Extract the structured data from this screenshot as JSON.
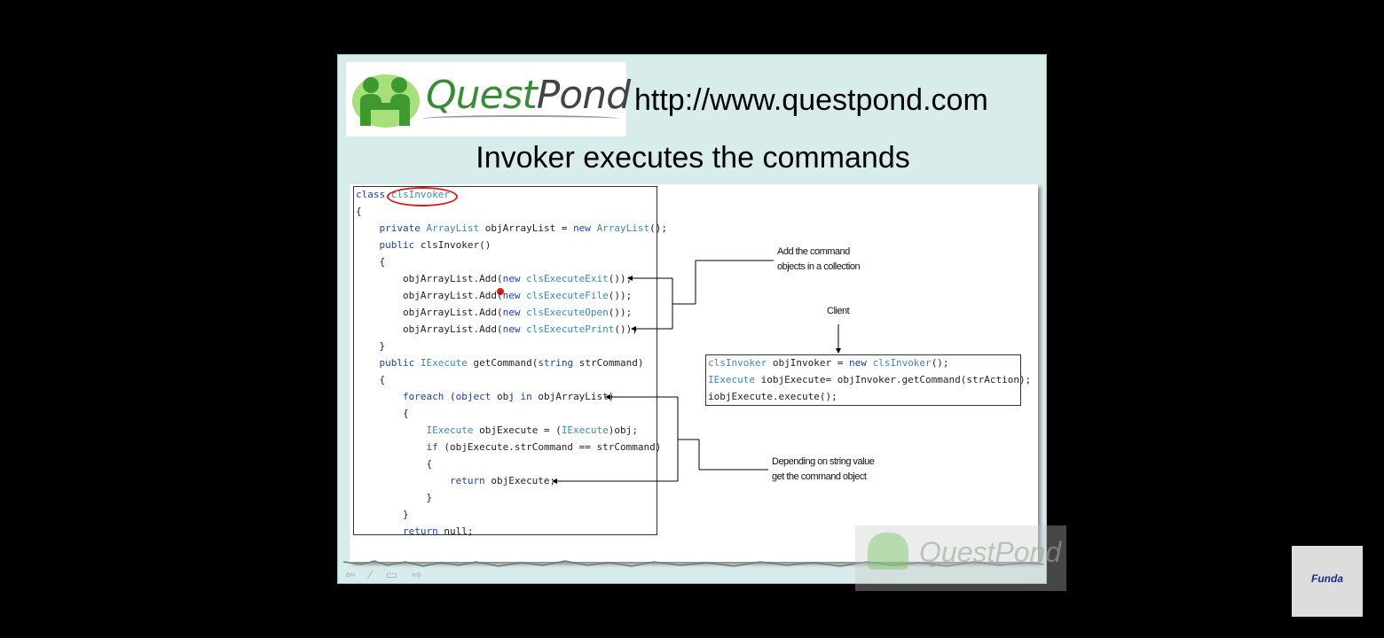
{
  "slide": {
    "logo": {
      "quest": "Quest",
      "pond": "Pond"
    },
    "url": "http://www.questpond.com",
    "heading": "Invoker executes the commands"
  },
  "code": [
    [
      {
        "t": "class ",
        "c": "kw"
      },
      {
        "t": "clsInvoker",
        "c": "ty"
      }
    ],
    [
      {
        "t": "{",
        "c": ""
      }
    ],
    [
      {
        "t": "    ",
        "c": ""
      },
      {
        "t": "private ",
        "c": "kw"
      },
      {
        "t": "ArrayList",
        "c": "ty"
      },
      {
        "t": " objArrayList = ",
        "c": ""
      },
      {
        "t": "new ",
        "c": "kw"
      },
      {
        "t": "ArrayList",
        "c": "ty"
      },
      {
        "t": "();",
        "c": ""
      }
    ],
    [
      {
        "t": "    ",
        "c": ""
      },
      {
        "t": "public ",
        "c": "kw"
      },
      {
        "t": "clsInvoker()",
        "c": ""
      }
    ],
    [
      {
        "t": "    {",
        "c": ""
      }
    ],
    [
      {
        "t": "        objArrayList.Add(",
        "c": ""
      },
      {
        "t": "new ",
        "c": "kw"
      },
      {
        "t": "clsExecuteExit",
        "c": "ty"
      },
      {
        "t": "());",
        "c": ""
      }
    ],
    [
      {
        "t": "        objArrayList.Add(",
        "c": ""
      },
      {
        "t": "new ",
        "c": "kw"
      },
      {
        "t": "clsExecuteFile",
        "c": "ty"
      },
      {
        "t": "());",
        "c": ""
      }
    ],
    [
      {
        "t": "        objArrayList.Add(",
        "c": ""
      },
      {
        "t": "new ",
        "c": "kw"
      },
      {
        "t": "clsExecuteOpen",
        "c": "ty"
      },
      {
        "t": "());",
        "c": ""
      }
    ],
    [
      {
        "t": "        objArrayList.Add(",
        "c": ""
      },
      {
        "t": "new ",
        "c": "kw"
      },
      {
        "t": "clsExecutePrint",
        "c": "ty"
      },
      {
        "t": "());",
        "c": ""
      }
    ],
    [
      {
        "t": "    }",
        "c": ""
      }
    ],
    [
      {
        "t": "    ",
        "c": ""
      },
      {
        "t": "public ",
        "c": "kw"
      },
      {
        "t": "IExecute",
        "c": "ty"
      },
      {
        "t": " getCommand(",
        "c": ""
      },
      {
        "t": "string",
        "c": "kw"
      },
      {
        "t": " strCommand)",
        "c": ""
      }
    ],
    [
      {
        "t": "    {",
        "c": ""
      }
    ],
    [
      {
        "t": "        ",
        "c": ""
      },
      {
        "t": "foreach ",
        "c": "kw"
      },
      {
        "t": "(",
        "c": ""
      },
      {
        "t": "object ",
        "c": "kw"
      },
      {
        "t": "obj ",
        "c": ""
      },
      {
        "t": "in ",
        "c": "kw"
      },
      {
        "t": "objArrayList)",
        "c": ""
      }
    ],
    [
      {
        "t": "        {",
        "c": ""
      }
    ],
    [
      {
        "t": "            ",
        "c": ""
      },
      {
        "t": "IExecute",
        "c": "ty"
      },
      {
        "t": " objExecute = (",
        "c": ""
      },
      {
        "t": "IExecute",
        "c": "ty"
      },
      {
        "t": ")obj;",
        "c": ""
      }
    ],
    [
      {
        "t": "            ",
        "c": ""
      },
      {
        "t": "if ",
        "c": "kw"
      },
      {
        "t": "(objExecute.strCommand == strCommand)",
        "c": ""
      }
    ],
    [
      {
        "t": "            {",
        "c": ""
      }
    ],
    [
      {
        "t": "                ",
        "c": ""
      },
      {
        "t": "return ",
        "c": "kw"
      },
      {
        "t": "objExecute;",
        "c": ""
      }
    ],
    [
      {
        "t": "            }",
        "c": ""
      }
    ],
    [
      {
        "t": "        }",
        "c": ""
      }
    ],
    [
      {
        "t": "        ",
        "c": ""
      },
      {
        "t": "return ",
        "c": "kw"
      },
      {
        "t": "null;",
        "c": ""
      }
    ]
  ],
  "client_code": [
    [
      {
        "t": "clsInvoker",
        "c": "ty"
      },
      {
        "t": " objInvoker = ",
        "c": ""
      },
      {
        "t": "new ",
        "c": "kw"
      },
      {
        "t": "clsInvoker",
        "c": "ty"
      },
      {
        "t": "();",
        "c": ""
      }
    ],
    [
      {
        "t": "IExecute",
        "c": "ty"
      },
      {
        "t": " iobjExecute= objInvoker.getCommand(strAction);",
        "c": ""
      }
    ],
    [
      {
        "t": "iobjExecute.execute();",
        "c": ""
      }
    ]
  ],
  "annotations": {
    "add_line1": "Add the command",
    "add_line2": "objects in a collection",
    "client": "Client",
    "depend_line1": "Depending on string value",
    "depend_line2": "get the command object"
  },
  "nav": "⇦ ⁄ ▭ ⇨",
  "watermark": "QuestPond",
  "badge": {
    "brand": "Funda"
  },
  "colors": {
    "keyword": "#1d3fae",
    "type": "#3c8aa8",
    "highlight": "#e01818",
    "logo_green": "#3a8a38"
  }
}
